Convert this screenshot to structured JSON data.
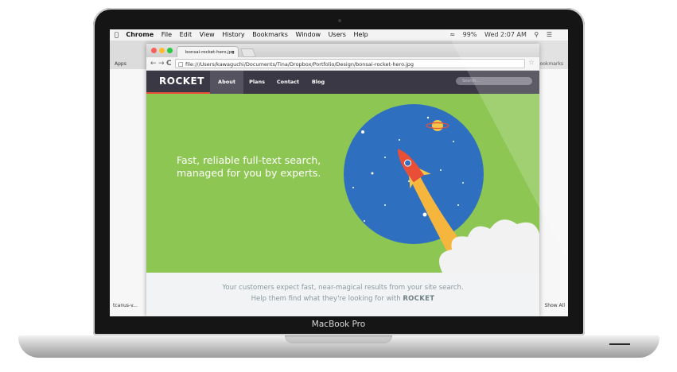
{
  "device": {
    "label": "MacBook Pro"
  },
  "menubar": {
    "app": "Chrome",
    "items": [
      "File",
      "Edit",
      "View",
      "History",
      "Bookmarks",
      "Window",
      "Users",
      "Help"
    ],
    "battery": "99%",
    "clock": "Wed 2:07 AM"
  },
  "background_window": {
    "apps_label": "Apps",
    "bookmarks_label": "Bookmarks",
    "bottom_item": "tcanus-v...",
    "show_all": "Show All"
  },
  "browser": {
    "tab_title": "bonsai-rocket-hero.jpg",
    "url": "file:///Users/kawaguchi/Documents/Tina/Dropbox/Portfolio/Design/bonsai-rocket-hero.jpg"
  },
  "site": {
    "logo": "ROCKET",
    "nav": [
      "About",
      "Plans",
      "Contact",
      "Blog"
    ],
    "search_placeholder": "Search...",
    "hero_line1": "Fast, reliable full-text search,",
    "hero_line2": "managed for you by experts.",
    "tagline_line1": "Your customers expect fast, near-magical results from your site search.",
    "tagline_line2": "Help them find what they're looking for with",
    "tagline_brand": "ROCKET"
  },
  "colors": {
    "hero_green": "#8dc653",
    "nav_bg": "#3a3845",
    "accent_red": "#e94f37",
    "planet_blue": "#2e6fc0"
  }
}
